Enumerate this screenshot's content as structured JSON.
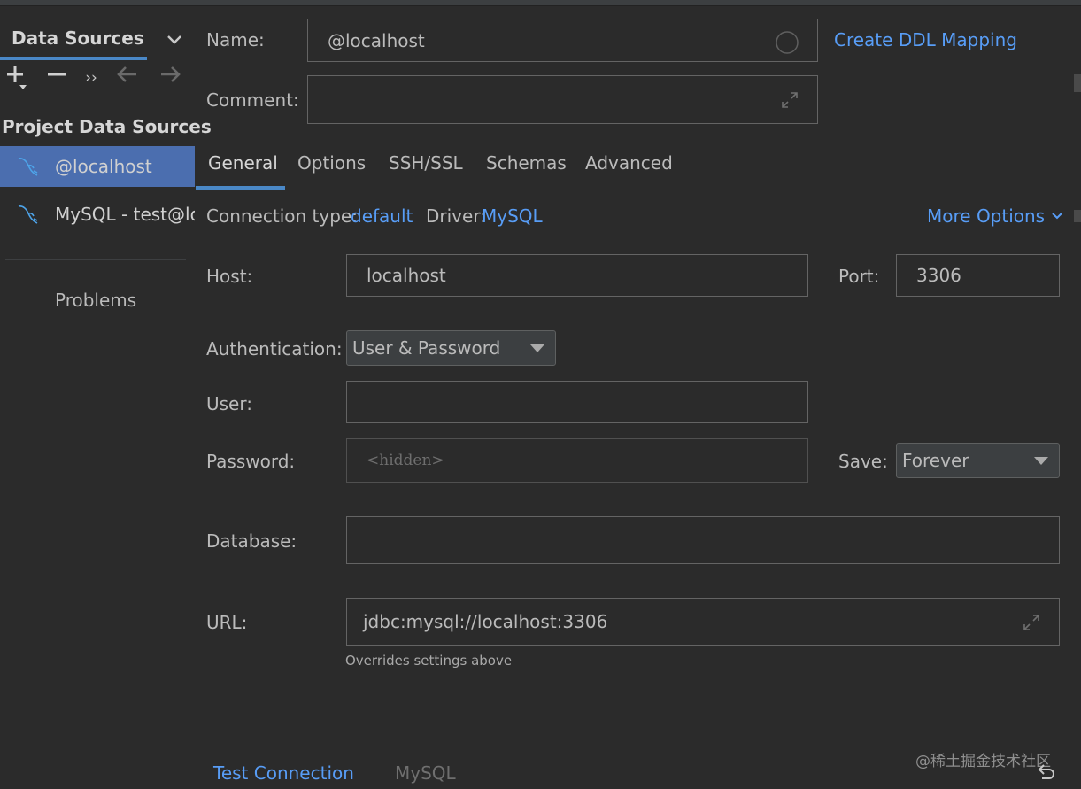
{
  "sidebar": {
    "tab_label": "Data Sources",
    "section_title": "Project Data Sources",
    "items": [
      {
        "label": "@localhost",
        "selected": true
      },
      {
        "label": "MySQL - test@localhost",
        "selected": false
      }
    ],
    "problems_label": "Problems",
    "toolbar_icons": [
      "add-icon",
      "remove-icon",
      "more-icon",
      "back-arrow-icon",
      "forward-arrow-icon"
    ]
  },
  "form": {
    "name_label": "Name:",
    "name_value": "@localhost",
    "comment_label": "Comment:",
    "comment_value": "",
    "create_ddl_link": "Create DDL Mapping"
  },
  "tabs": [
    {
      "label": "General",
      "active": true
    },
    {
      "label": "Options"
    },
    {
      "label": "SSH/SSL"
    },
    {
      "label": "Schemas"
    },
    {
      "label": "Advanced"
    }
  ],
  "connection": {
    "type_label": "Connection type:",
    "type_value": "default",
    "driver_label": "Driver:",
    "driver_value": "MySQL",
    "more_options": "More Options"
  },
  "general": {
    "host_label": "Host:",
    "host_value": "localhost",
    "port_label": "Port:",
    "port_value": "3306",
    "auth_label": "Authentication:",
    "auth_value": "User & Password",
    "user_label": "User:",
    "user_value": "",
    "password_label": "Password:",
    "password_placeholder": "<hidden>",
    "save_label": "Save:",
    "save_value": "Forever",
    "database_label": "Database:",
    "database_value": "",
    "url_label": "URL:",
    "url_value": "jdbc:mysql://localhost:3306",
    "url_hint": "Overrides settings above"
  },
  "footer": {
    "test_connection": "Test Connection",
    "driver_name": "MySQL",
    "watermark": "@稀土掘金技术社区"
  },
  "colors": {
    "background": "#2b2b2b",
    "selection": "#4b6eaf",
    "link": "#589df6",
    "accent": "#4a88c7"
  }
}
